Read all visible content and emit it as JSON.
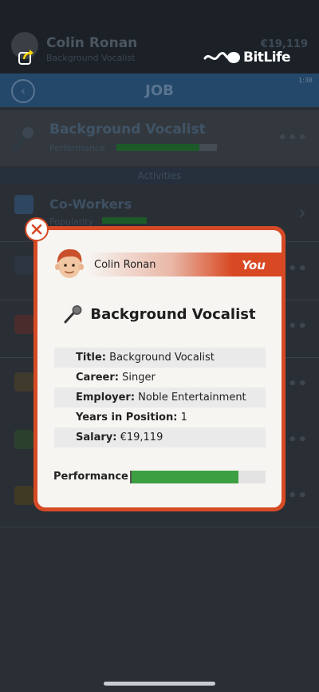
{
  "app": {
    "logo_text": "BitLife",
    "brand_color": "#d64a25"
  },
  "background": {
    "header": {
      "name": "Colin Ronan",
      "subtitle": "Background Vocalist",
      "money": "€19,119"
    },
    "nav": {
      "title": "JOB",
      "time": "1:38"
    },
    "job": {
      "title": "Background Vocalist",
      "performance_label": "Performance"
    },
    "section_header": "Activities",
    "rows": [
      {
        "title": "Co-Workers",
        "sub": "Popularity"
      }
    ]
  },
  "modal": {
    "person": {
      "name": "Colin Ronan",
      "relation": "You"
    },
    "job_title": "Background Vocalist",
    "details": [
      {
        "label": "Title:",
        "value": "Background Vocalist"
      },
      {
        "label": "Career:",
        "value": "Singer"
      },
      {
        "label": "Employer:",
        "value": "Noble Entertainment"
      },
      {
        "label": "Years in Position:",
        "value": "1"
      },
      {
        "label": "Salary:",
        "value": "€19,119"
      }
    ],
    "performance": {
      "label": "Performance",
      "value_fraction": 0.8,
      "color": "#3ca043"
    }
  },
  "icons": {
    "share": "share-icon",
    "close": "close-icon",
    "mic": "microphone-icon",
    "avatar": "avatar-icon",
    "back": "back-arrow-icon"
  }
}
